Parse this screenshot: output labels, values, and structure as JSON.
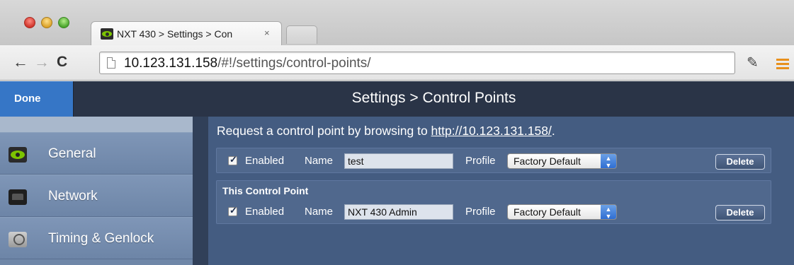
{
  "browser": {
    "tab_title": "NXT 430 > Settings > Con",
    "tab_close": "×",
    "url_host": "10.123.131.158",
    "url_path": "/#!/settings/control-points/"
  },
  "header": {
    "done_label": "Done",
    "title": "Settings > Control Points"
  },
  "sidebar": {
    "items": [
      {
        "label": "General",
        "icon": "nxt-eye-icon"
      },
      {
        "label": "Network",
        "icon": "network-port-icon"
      },
      {
        "label": "Timing & Genlock",
        "icon": "ref-clock-icon"
      }
    ]
  },
  "main": {
    "request_prefix": "Request a control point by browsing to ",
    "request_link": "http://10.123.131.158/",
    "request_suffix": ".",
    "control_points": [
      {
        "title": "",
        "enabled": true,
        "enabled_label": "Enabled",
        "name_label": "Name",
        "name_value": "test",
        "profile_label": "Profile",
        "profile_value": "Factory Default",
        "delete_label": "Delete"
      },
      {
        "title": "This Control Point",
        "enabled": true,
        "enabled_label": "Enabled",
        "name_label": "Name",
        "name_value": "NXT 430 Admin",
        "profile_label": "Profile",
        "profile_value": "Factory Default",
        "delete_label": "Delete"
      }
    ]
  },
  "colors": {
    "header_bg": "#2a3447",
    "done_bg": "#3676c6",
    "content_bg": "#445c81",
    "sidebar_bg": "#6f87a8"
  }
}
